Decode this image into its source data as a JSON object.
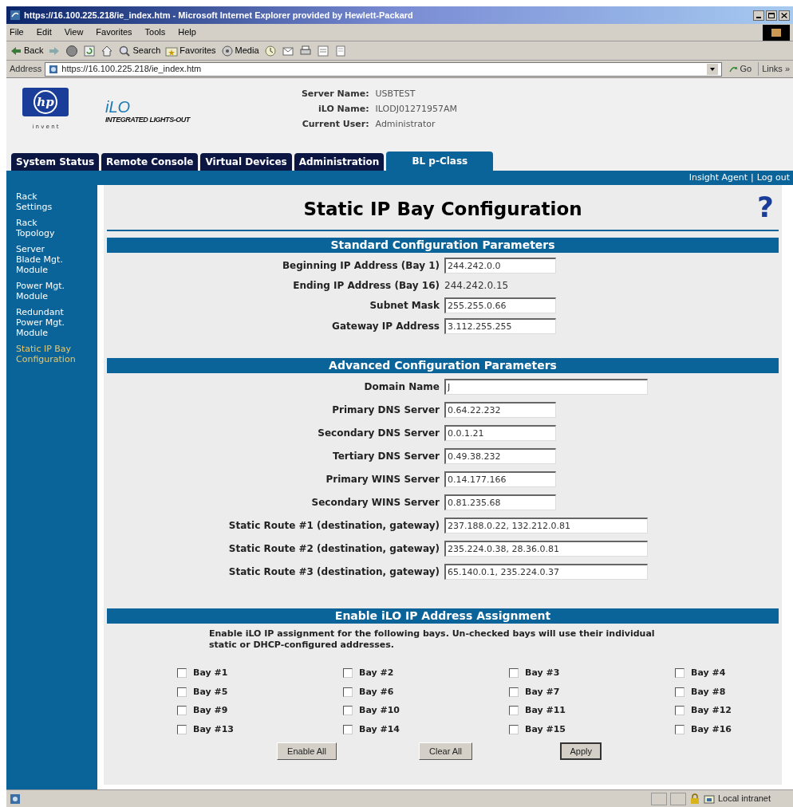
{
  "window": {
    "title": "https://16.100.225.218/ie_index.htm - Microsoft Internet Explorer provided by Hewlett-Packard"
  },
  "menu": [
    "File",
    "Edit",
    "View",
    "Favorites",
    "Tools",
    "Help"
  ],
  "toolbar": [
    {
      "kind": "back",
      "label": "Back"
    },
    {
      "kind": "forward"
    },
    {
      "kind": "stop"
    },
    {
      "kind": "refresh"
    },
    {
      "kind": "home"
    },
    {
      "kind": "search",
      "label": "Search"
    },
    {
      "kind": "favorites",
      "label": "Favorites"
    },
    {
      "kind": "media",
      "label": "Media"
    },
    {
      "kind": "history"
    },
    {
      "kind": "mail"
    },
    {
      "kind": "print"
    },
    {
      "kind": "edit"
    },
    {
      "kind": "discuss"
    }
  ],
  "address": {
    "label": "Address",
    "value": "https://16.100.225.218/ie_index.htm",
    "go": "Go",
    "links": "Links »"
  },
  "header": {
    "logo": "hp",
    "tagline": "i n v e n t",
    "product": "iLO",
    "product_sub": "INTEGRATED LIGHTS-OUT",
    "info": [
      {
        "label": "Server Name:",
        "value": "USBTEST"
      },
      {
        "label": "iLO Name:",
        "value": "ILODJ01271957AM"
      },
      {
        "label": "Current User:",
        "value": "Administrator"
      }
    ]
  },
  "tabs": [
    {
      "label": "System Status",
      "selected": false
    },
    {
      "label": "Remote Console",
      "selected": false
    },
    {
      "label": "Virtual Devices",
      "selected": false
    },
    {
      "label": "Administration",
      "selected": false
    },
    {
      "label": "BL p-Class",
      "selected": true
    }
  ],
  "top_links": [
    "Insight Agent",
    "|",
    "Log out"
  ],
  "sidebar": {
    "items": [
      {
        "label": "Rack Settings",
        "selected": false
      },
      {
        "label": "Rack Topology",
        "selected": false
      },
      {
        "label": "Server Blade Mgt. Module",
        "selected": false
      },
      {
        "label": "Power Mgt. Module",
        "selected": false
      },
      {
        "label": "Redundant Power Mgt. Module",
        "selected": false
      },
      {
        "label": "Static IP Bay Configuration",
        "selected": true
      }
    ]
  },
  "page": {
    "title": "Static IP Bay Configuration",
    "help": "?"
  },
  "sections": [
    {
      "title": "Standard Configuration Parameters",
      "rows": [
        {
          "label": "Beginning IP Address (Bay 1)",
          "value": "244.242.0.0",
          "kind": "field"
        },
        {
          "label": "Ending IP Address (Bay 16)",
          "value": "244.242.0.15",
          "kind": "static"
        },
        {
          "label": "Subnet Mask",
          "value": "255.255.0.66",
          "kind": "field"
        },
        {
          "label": "Gateway IP Address",
          "value": "3.112.255.255",
          "kind": "field"
        }
      ]
    },
    {
      "title": "Advanced Configuration Parameters",
      "rows": [
        {
          "label": "Domain Name",
          "value": "J",
          "kind": "wide"
        },
        {
          "label": "Primary DNS Server",
          "value": "0.64.22.232",
          "kind": "field"
        },
        {
          "label": "Secondary DNS Server",
          "value": "0.0.1.21",
          "kind": "field"
        },
        {
          "label": "Tertiary DNS Server",
          "value": "0.49.38.232",
          "kind": "field"
        },
        {
          "label": "Primary WINS Server",
          "value": "0.14.177.166",
          "kind": "field"
        },
        {
          "label": "Secondary WINS Server",
          "value": "0.81.235.68",
          "kind": "field"
        },
        {
          "label": "Static Route #1 (destination, gateway)",
          "value": "237.188.0.22, 132.212.0.81",
          "kind": "wide"
        },
        {
          "label": "Static Route #2 (destination, gateway)",
          "value": "235.224.0.38, 28.36.0.81",
          "kind": "wide"
        },
        {
          "label": "Static Route #3 (destination, gateway)",
          "value": "65.140.0.1, 235.224.0.37",
          "kind": "wide"
        }
      ]
    }
  ],
  "assignment": {
    "title": "Enable iLO IP Address Assignment",
    "description": "Enable iLO IP assignment for the following bays. Un-checked bays will use their individual static or DHCP-configured addresses.",
    "bays": [
      {
        "label": "Bay #1",
        "checked": false
      },
      {
        "label": "Bay #2",
        "checked": false
      },
      {
        "label": "Bay #3",
        "checked": false
      },
      {
        "label": "Bay #4",
        "checked": false
      },
      {
        "label": "Bay #5",
        "checked": false
      },
      {
        "label": "Bay #6",
        "checked": false
      },
      {
        "label": "Bay #7",
        "checked": false
      },
      {
        "label": "Bay #8",
        "checked": false
      },
      {
        "label": "Bay #9",
        "checked": false
      },
      {
        "label": "Bay #10",
        "checked": false
      },
      {
        "label": "Bay #11",
        "checked": false
      },
      {
        "label": "Bay #12",
        "checked": false
      },
      {
        "label": "Bay #13",
        "checked": false
      },
      {
        "label": "Bay #14",
        "checked": false
      },
      {
        "label": "Bay #15",
        "checked": false
      },
      {
        "label": "Bay #16",
        "checked": false
      }
    ],
    "buttons": [
      "Enable All",
      "Clear All",
      "Apply"
    ]
  },
  "status_bar": {
    "zone": "Local intranet"
  }
}
